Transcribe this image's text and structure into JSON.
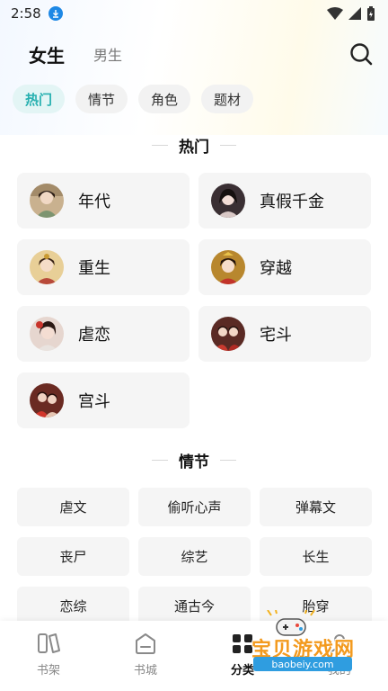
{
  "status_bar": {
    "time": "2:58"
  },
  "header": {
    "tabs": [
      {
        "label": "女生",
        "active": true
      },
      {
        "label": "男生",
        "active": false
      }
    ]
  },
  "filter_chips": [
    {
      "label": "热门",
      "active": true
    },
    {
      "label": "情节",
      "active": false
    },
    {
      "label": "角色",
      "active": false
    },
    {
      "label": "题材",
      "active": false
    }
  ],
  "sections": {
    "hot": {
      "title": "热门",
      "items": [
        {
          "label": "年代",
          "avatar": "portrait-icon"
        },
        {
          "label": "真假千金",
          "avatar": "portrait-icon"
        },
        {
          "label": "重生",
          "avatar": "portrait-icon"
        },
        {
          "label": "穿越",
          "avatar": "portrait-icon"
        },
        {
          "label": "虐恋",
          "avatar": "portrait-icon"
        },
        {
          "label": "宅斗",
          "avatar": "portrait-icon"
        },
        {
          "label": "宫斗",
          "avatar": "portrait-icon"
        }
      ]
    },
    "plot": {
      "title": "情节",
      "items": [
        "虐文",
        "偷听心声",
        "弹幕文",
        "丧尸",
        "综艺",
        "长生",
        "恋综",
        "通古今",
        "胎穿"
      ]
    }
  },
  "bottom_nav": [
    {
      "label": "书架",
      "icon": "bookshelf-icon",
      "active": false
    },
    {
      "label": "书城",
      "icon": "bookstore-icon",
      "active": false
    },
    {
      "label": "分类",
      "icon": "category-icon",
      "active": true
    },
    {
      "label": "我的",
      "icon": "profile-icon",
      "active": false
    }
  ],
  "watermark": {
    "brand": "宝贝游戏网",
    "domain": "baobeiy.com"
  },
  "colors": {
    "accent": "#27b0b0",
    "chip_active_bg": "#e3f5f5",
    "card_bg": "#f5f5f5",
    "download_badge": "#1e88e5",
    "watermark_orange": "#f39a1e",
    "watermark_blue": "#2f9de0"
  }
}
